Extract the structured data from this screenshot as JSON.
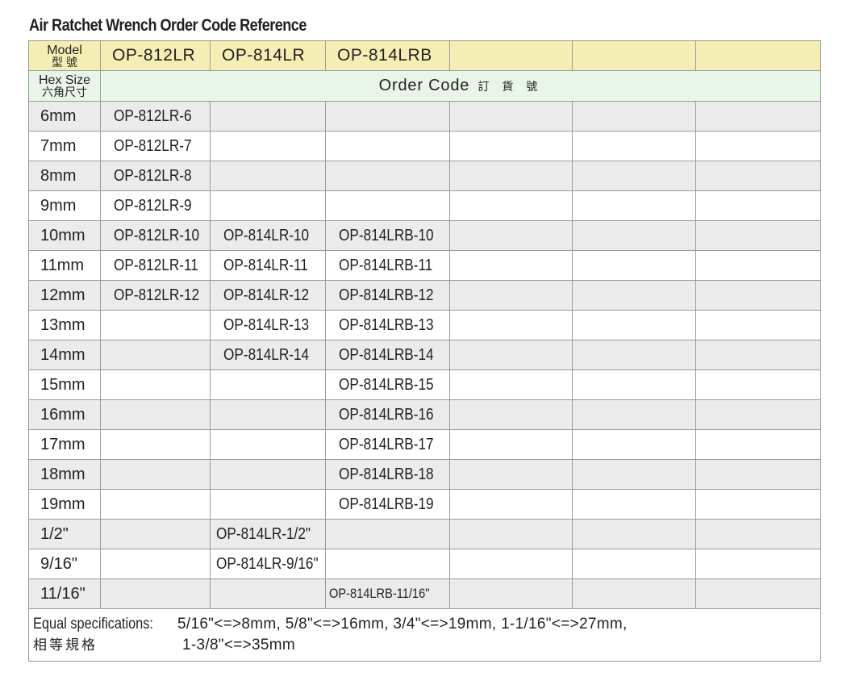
{
  "title": "Air Ratchet Wrench Order Code Reference",
  "header": {
    "model_en": "Model",
    "model_zh": "型 號",
    "models": [
      "OP-812LR",
      "OP-814LR",
      "OP-814LRB",
      "",
      "",
      ""
    ],
    "hex_en": "Hex Size",
    "hex_zh": "六角尺寸",
    "order_code_en": "Order Code",
    "order_code_zh": "訂 貨 號"
  },
  "rows": [
    {
      "size": "6mm",
      "codes": [
        "OP-812LR-6",
        "",
        "",
        "",
        "",
        ""
      ]
    },
    {
      "size": "7mm",
      "codes": [
        "OP-812LR-7",
        "",
        "",
        "",
        "",
        ""
      ]
    },
    {
      "size": "8mm",
      "codes": [
        "OP-812LR-8",
        "",
        "",
        "",
        "",
        ""
      ]
    },
    {
      "size": "9mm",
      "codes": [
        "OP-812LR-9",
        "",
        "",
        "",
        "",
        ""
      ]
    },
    {
      "size": "10mm",
      "codes": [
        "OP-812LR-10",
        "OP-814LR-10",
        "OP-814LRB-10",
        "",
        "",
        ""
      ]
    },
    {
      "size": "11mm",
      "codes": [
        "OP-812LR-11",
        "OP-814LR-11",
        "OP-814LRB-11",
        "",
        "",
        ""
      ]
    },
    {
      "size": "12mm",
      "codes": [
        "OP-812LR-12",
        "OP-814LR-12",
        "OP-814LRB-12",
        "",
        "",
        ""
      ]
    },
    {
      "size": "13mm",
      "codes": [
        "",
        "OP-814LR-13",
        "OP-814LRB-13",
        "",
        "",
        ""
      ]
    },
    {
      "size": "14mm",
      "codes": [
        "",
        "OP-814LR-14",
        "OP-814LRB-14",
        "",
        "",
        ""
      ]
    },
    {
      "size": "15mm",
      "codes": [
        "",
        "",
        "OP-814LRB-15",
        "",
        "",
        ""
      ]
    },
    {
      "size": "16mm",
      "codes": [
        "",
        "",
        "OP-814LRB-16",
        "",
        "",
        ""
      ]
    },
    {
      "size": "17mm",
      "codes": [
        "",
        "",
        "OP-814LRB-17",
        "",
        "",
        ""
      ]
    },
    {
      "size": "18mm",
      "codes": [
        "",
        "",
        "OP-814LRB-18",
        "",
        "",
        ""
      ]
    },
    {
      "size": "19mm",
      "codes": [
        "",
        "",
        "OP-814LRB-19",
        "",
        "",
        ""
      ]
    },
    {
      "size": "1/2\"",
      "codes": [
        "",
        "OP-814LR-1/2\"",
        "",
        "",
        "",
        ""
      ]
    },
    {
      "size": "9/16\"",
      "codes": [
        "",
        "OP-814LR-9/16\"",
        "",
        "",
        "",
        ""
      ]
    },
    {
      "size": "11/16\"",
      "codes": [
        "",
        "",
        "OP-814LRB-11/16\"",
        "",
        "",
        ""
      ]
    }
  ],
  "footer": {
    "label_en": "Equal specifications:",
    "label_zh": "相等規格",
    "line1": "5/16\"<=>8mm,  5/8\"<=>16mm,  3/4\"<=>19mm, 1-1/16\"<=>27mm,",
    "line2": "1-3/8\"<=>35mm"
  }
}
